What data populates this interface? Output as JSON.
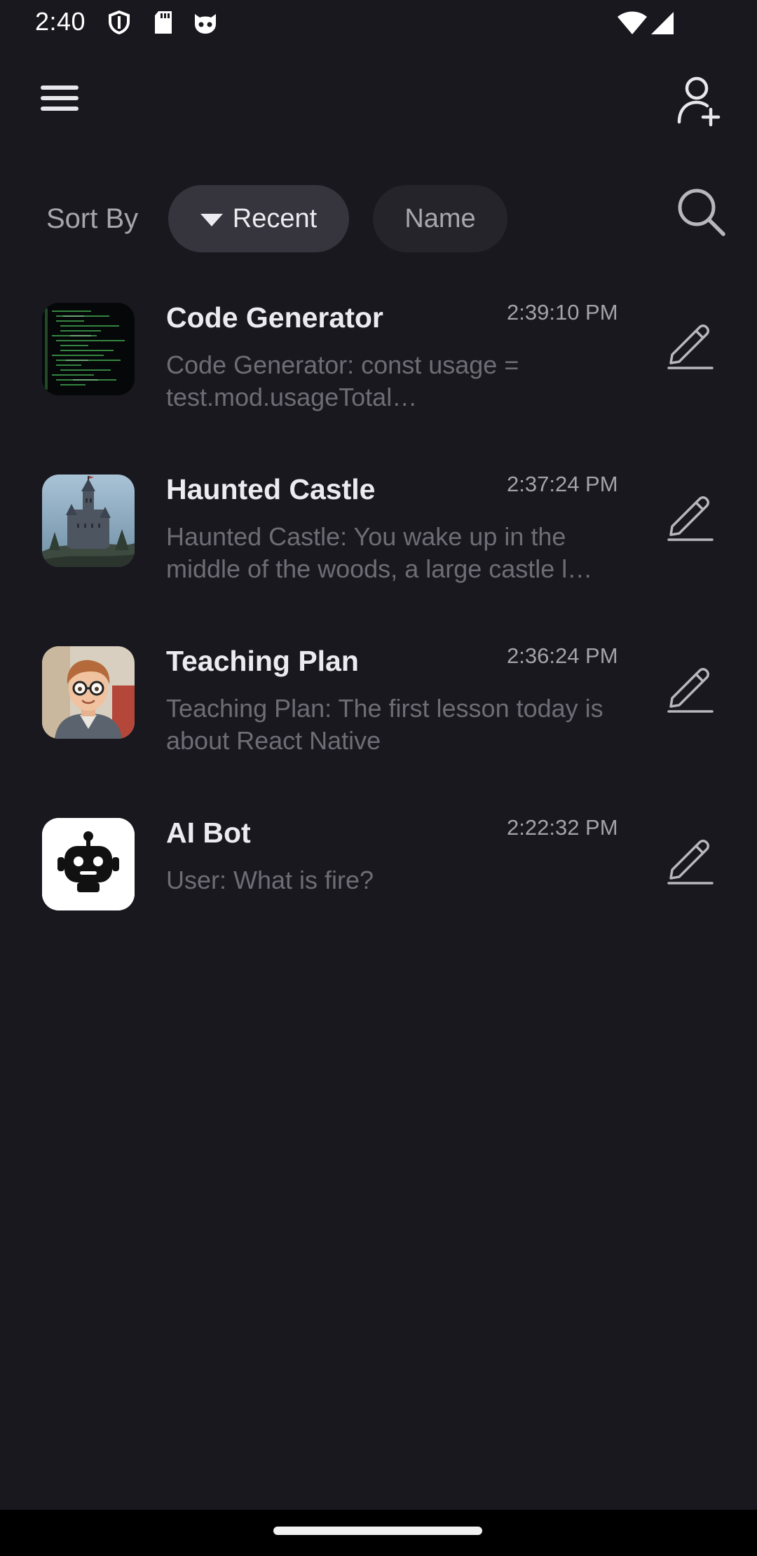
{
  "status_bar": {
    "time": "2:40",
    "left_icons": [
      "shield-icon",
      "sd-card-icon",
      "cat-face-icon"
    ],
    "right_icons": [
      "wifi-icon",
      "cellular-signal-icon"
    ]
  },
  "header": {
    "menu_icon": "hamburger-menu-icon",
    "add_user_icon": "add-user-icon"
  },
  "sort": {
    "label": "Sort By",
    "options": [
      {
        "label": "Recent",
        "selected": true,
        "icon": "caret-down-icon"
      },
      {
        "label": "Name",
        "selected": false
      }
    ],
    "search_icon": "search-icon"
  },
  "chats": [
    {
      "title": "Code Generator",
      "time": "2:39:10 PM",
      "preview": "Code Generator:  const usage = test.mod.usageTotal…",
      "avatar": "code-terminal-avatar"
    },
    {
      "title": "Haunted Castle",
      "time": "2:37:24 PM",
      "preview": "Haunted Castle:  You wake up in the middle of the woods, a large castle l…",
      "avatar": "castle-avatar"
    },
    {
      "title": "Teaching Plan",
      "time": "2:36:24 PM",
      "preview": "Teaching Plan:  The first lesson today is about React Native",
      "avatar": "teacher-avatar"
    },
    {
      "title": "AI Bot",
      "time": "2:22:32 PM",
      "preview": "User:  What is fire?",
      "avatar": "robot-avatar"
    }
  ],
  "colors": {
    "background": "#19181f",
    "chip_selected": "#36353d",
    "chip_unselected": "#25242b",
    "title_text": "#ecebf0",
    "preview_text": "#6e6d75",
    "icon": "#b8b7be"
  }
}
